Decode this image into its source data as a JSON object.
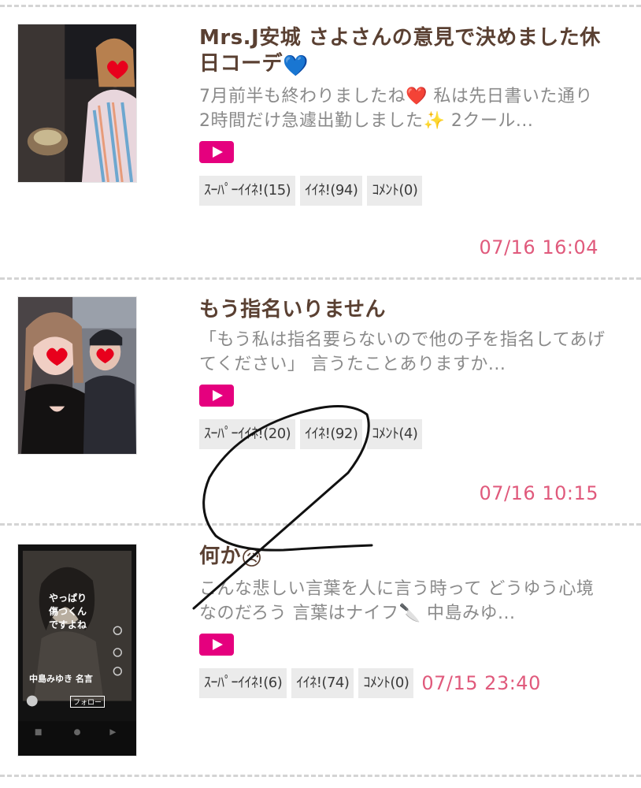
{
  "posts": [
    {
      "title": "Mrs.J安城 さよさんの意見で決めました休日コーデ",
      "title_emoji": "💙",
      "excerpt": "7月前半も終わりましたね❤️ 私は先日書いた通り 2時間だけ急遽出勤しました✨ 2クール...",
      "reactions": {
        "super_like": "ｽｰﾊﾟｰｲｲﾈ!(15)",
        "like": "ｲｲﾈ!(94)",
        "comment": "ｺﾒﾝﾄ(0)"
      },
      "date": "07/16 16:04"
    },
    {
      "title": "もう指名いりません",
      "title_emoji": "",
      "excerpt": "「もう私は指名要らないので他の子を指名してあげてください」 言うたことありますか...",
      "reactions": {
        "super_like": "ｽｰﾊﾟｰｲｲﾈ!(20)",
        "like": "ｲｲﾈ!(92)",
        "comment": "ｺﾒﾝﾄ(4)"
      },
      "date": "07/16 10:15"
    },
    {
      "title": "何か",
      "title_emoji": "😥",
      "excerpt": "こんな悲しい言葉を人に言う時って どうゆう心境なのだろう 言葉はナイフ🔪 中島みゆ...",
      "reactions": {
        "super_like": "ｽｰﾊﾟｰｲｲﾈ!(6)",
        "like": "ｲｲﾈ!(74)",
        "comment": "ｺﾒﾝﾄ(0)"
      },
      "date": "07/15 23:40",
      "thumb_overlay": {
        "quote": "やっぱり 傷つくんですよね",
        "caption": "中島みゆき 名言",
        "follow": "フォロー"
      }
    }
  ],
  "icons": {
    "video": "play-video-icon"
  },
  "colors": {
    "accent_pink": "#e5007e",
    "date_pink": "#e05a7c",
    "title_brown": "#5a4032",
    "excerpt_gray": "#8a8a8a",
    "pill_bg": "#ebebeb"
  }
}
